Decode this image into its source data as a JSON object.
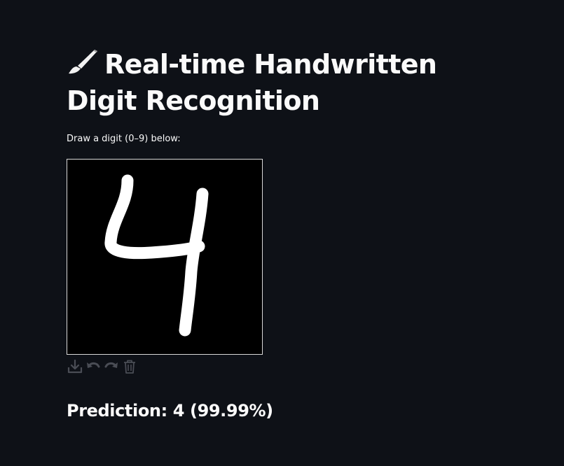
{
  "header": {
    "title_emoji": "🖌",
    "title": "Real-time Handwritten Digit Recognition"
  },
  "instructions": "Draw a digit (0–9) below:",
  "canvas": {
    "background_color": "#000000",
    "stroke_color": "#ffffff",
    "drawn_digit": "4"
  },
  "toolbar": {
    "buttons": [
      {
        "icon": "download-icon",
        "label": "Download"
      },
      {
        "icon": "undo-icon",
        "label": "Undo"
      },
      {
        "icon": "redo-icon",
        "label": "Redo"
      },
      {
        "icon": "trash-icon",
        "label": "Clear"
      }
    ]
  },
  "prediction": {
    "text": "Prediction: 4 (99.99%)"
  },
  "colors": {
    "background": "#0e1117",
    "text": "#fafafa",
    "icon": "#4a4d55"
  }
}
